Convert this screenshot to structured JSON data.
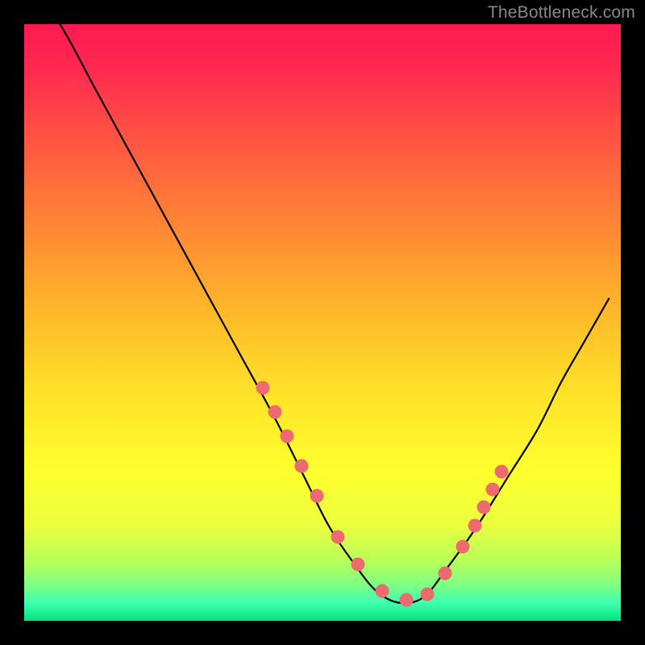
{
  "watermark": "TheBottleneck.com",
  "chart_data": {
    "type": "line",
    "title": "",
    "xlabel": "",
    "ylabel": "",
    "xlim": [
      0,
      100
    ],
    "ylim": [
      0,
      100
    ],
    "bg_gradient_stops": [
      {
        "offset": 0.0,
        "color": "#ff1a52"
      },
      {
        "offset": 0.07,
        "color": "#ff2850"
      },
      {
        "offset": 0.2,
        "color": "#ff5742"
      },
      {
        "offset": 0.35,
        "color": "#ff8a33"
      },
      {
        "offset": 0.5,
        "color": "#ffbe29"
      },
      {
        "offset": 0.62,
        "color": "#ffe229"
      },
      {
        "offset": 0.75,
        "color": "#feff2d"
      },
      {
        "offset": 0.84,
        "color": "#eaff3f"
      },
      {
        "offset": 0.9,
        "color": "#b8ff5a"
      },
      {
        "offset": 0.94,
        "color": "#7eff83"
      },
      {
        "offset": 0.97,
        "color": "#3dffb0"
      },
      {
        "offset": 1.0,
        "color": "#00e47a"
      }
    ],
    "series": [
      {
        "name": "bottleneck-curve",
        "x": [
          0,
          6,
          12,
          18,
          24,
          30,
          36,
          42,
          47,
          51,
          55,
          59,
          63,
          67,
          71,
          76,
          81,
          86,
          90,
          94,
          98
        ],
        "values": [
          108,
          100,
          89,
          78,
          67,
          56,
          45,
          34,
          24,
          16,
          10,
          5,
          3,
          4,
          9,
          16,
          24,
          32,
          40,
          47,
          54
        ]
      }
    ],
    "markers": {
      "name": "highlight-dots",
      "x": [
        40.0,
        42.0,
        44.0,
        46.5,
        49.0,
        52.5,
        56.0,
        60.0,
        64.0,
        67.5,
        70.5,
        73.5,
        75.5,
        77.0,
        78.5,
        80.0
      ],
      "values": [
        39.0,
        35.0,
        31.0,
        26.0,
        21.0,
        14.0,
        9.5,
        5.0,
        3.5,
        4.5,
        8.0,
        12.5,
        16.0,
        19.0,
        22.0,
        25.0
      ]
    }
  }
}
